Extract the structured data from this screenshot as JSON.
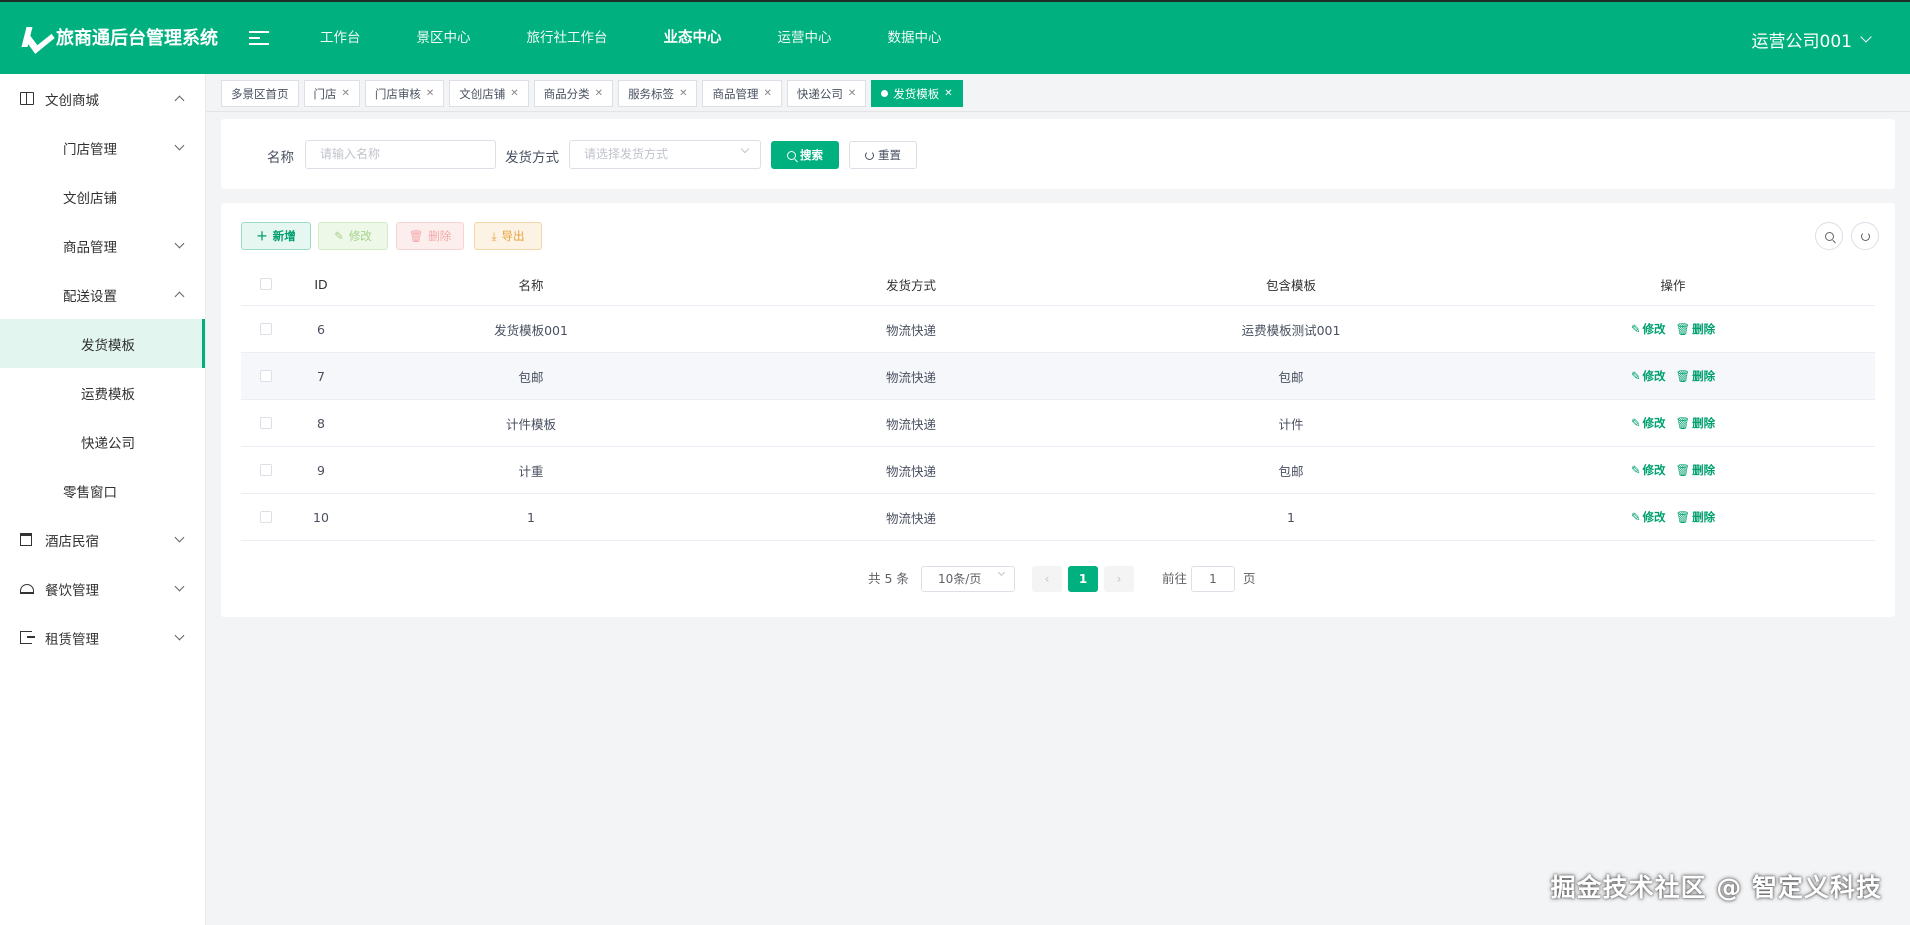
{
  "header": {
    "title": "旅商通后台管理系统",
    "nav": [
      "工作台",
      "景区中心",
      "旅行社工作台",
      "业态中心",
      "运营中心",
      "数据中心"
    ],
    "active_nav_index": 3,
    "user": "运营公司001",
    "color": "#00b07e"
  },
  "sidebar": {
    "shop": {
      "label": "文创商城",
      "icon": "book-icon"
    },
    "store_mgmt": "门店管理",
    "creative_store": "文创店铺",
    "goods_mgmt": "商品管理",
    "delivery_settings": "配送设置",
    "ship_template": "发货模板",
    "freight_template": "运费模板",
    "express_company": "快递公司",
    "retail_window": "零售窗口",
    "hotel": {
      "label": "酒店民宿",
      "icon": "hotel-icon"
    },
    "catering": {
      "label": "餐饮管理",
      "icon": "food-icon"
    },
    "rental": {
      "label": "租赁管理",
      "icon": "rent-icon"
    }
  },
  "tabs": [
    "多景区首页",
    "门店",
    "门店审核",
    "文创店铺",
    "商品分类",
    "服务标签",
    "商品管理",
    "快递公司",
    "发货模板"
  ],
  "search": {
    "name_label": "名称",
    "name_placeholder": "请输入名称",
    "ship_label": "发货方式",
    "ship_placeholder": "请选择发货方式",
    "search_btn": "搜索",
    "reset_btn": "重置"
  },
  "toolbar": {
    "add": "新增",
    "edit": "修改",
    "delete": "删除",
    "export": "导出"
  },
  "table": {
    "headers": {
      "id": "ID",
      "name": "名称",
      "ship": "发货方式",
      "template": "包含模板",
      "ops": "操作"
    },
    "edit_label": "修改",
    "delete_label": "删除",
    "rows": [
      {
        "id": "6",
        "name": "发货模板001",
        "ship": "物流快递",
        "template": "运费模板测试001"
      },
      {
        "id": "7",
        "name": "包邮",
        "ship": "物流快递",
        "template": "包邮"
      },
      {
        "id": "8",
        "name": "计件模板",
        "ship": "物流快递",
        "template": "计件"
      },
      {
        "id": "9",
        "name": "计重",
        "ship": "物流快递",
        "template": "包邮"
      },
      {
        "id": "10",
        "name": "1",
        "ship": "物流快递",
        "template": "1"
      }
    ]
  },
  "pagination": {
    "total": "共 5 条",
    "page_size": "10条/页",
    "current": "1",
    "goto_prefix": "前往",
    "goto_value": "1",
    "goto_suffix": "页"
  },
  "watermark": "掘金技术社区 @ 智定义科技"
}
